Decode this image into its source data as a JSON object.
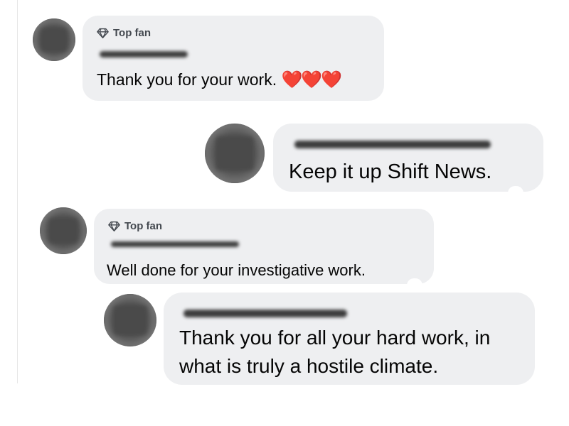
{
  "comments": [
    {
      "badge": "Top fan",
      "text": "Thank you for your work.",
      "emoji": "❤️❤️❤️"
    },
    {
      "badge": "",
      "text": "Keep it up Shift News."
    },
    {
      "badge": "Top fan",
      "text": "Well done for your investigative work."
    },
    {
      "badge": "",
      "text_line1": "Thank you for all your hard work, in",
      "text_line2": "what is truly a hostile climate."
    }
  ],
  "icons": {
    "top_fan_badge": "diamond-icon"
  },
  "colors": {
    "bubble": "#eeeff1",
    "text": "#050505",
    "badge_text": "#444950",
    "heart": "#e0242b"
  }
}
